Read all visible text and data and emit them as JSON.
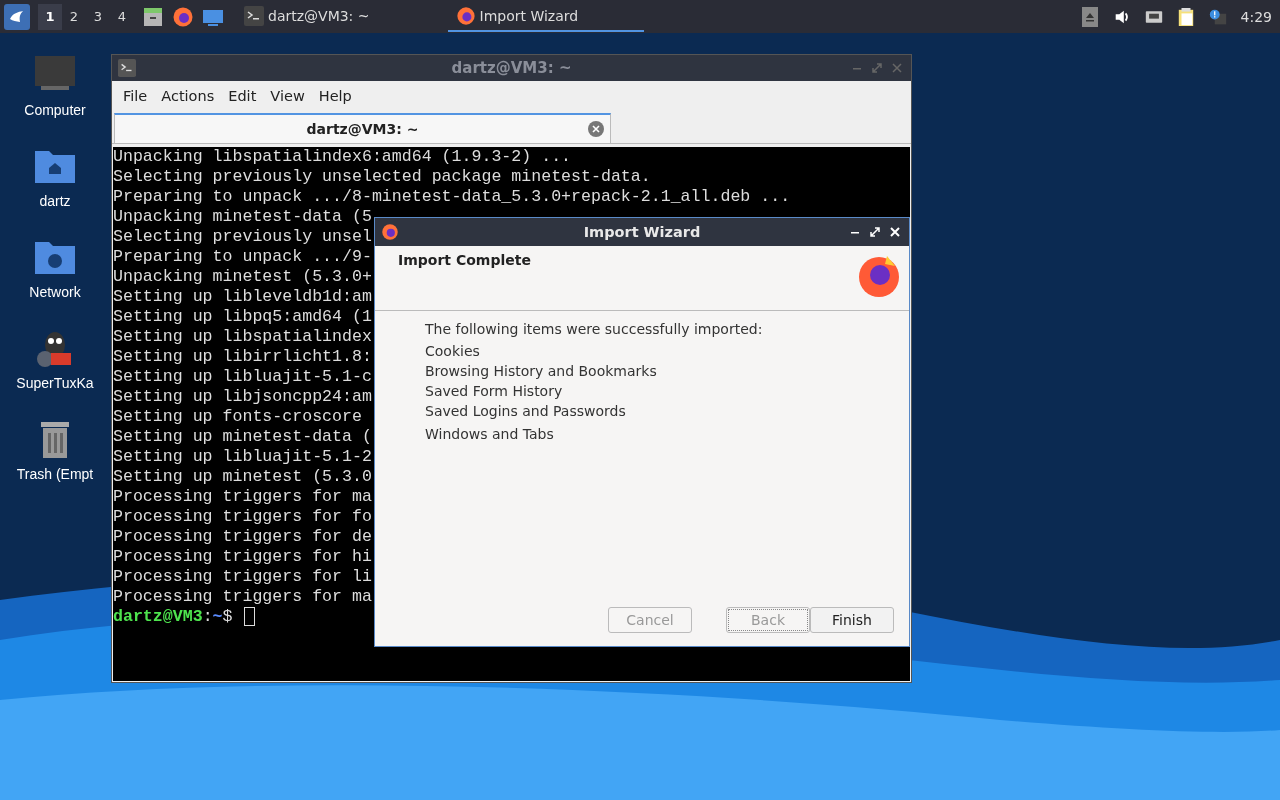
{
  "taskbar": {
    "workspaces": [
      {
        "label": "1",
        "selected": true
      },
      {
        "label": "2",
        "selected": false
      },
      {
        "label": "3",
        "selected": false
      },
      {
        "label": "4",
        "selected": false
      }
    ],
    "tasks": [
      {
        "label": "dartz@VM3: ~",
        "kind": "terminal",
        "selected": false
      },
      {
        "label": "Import Wizard",
        "kind": "firefox",
        "selected": true
      }
    ],
    "clock": "4:29"
  },
  "desktop_icons": [
    {
      "label": "Computer",
      "kind": "computer"
    },
    {
      "label": "dartz",
      "kind": "home"
    },
    {
      "label": "Network",
      "kind": "network"
    },
    {
      "label": "SuperTuxKa",
      "kind": "game"
    },
    {
      "label": "Trash (Empt",
      "kind": "trash"
    }
  ],
  "terminal": {
    "title": "dartz@VM3: ~",
    "menu": [
      "File",
      "Actions",
      "Edit",
      "View",
      "Help"
    ],
    "tab": "dartz@VM3: ~",
    "lines": [
      "Unpacking libspatialindex6:amd64 (1.9.3-2) ...",
      "Selecting previously unselected package minetest-data.",
      "Preparing to unpack .../8-minetest-data_5.3.0+repack-2.1_all.deb ...",
      "Unpacking minetest-data (5",
      "Selecting previously unsel",
      "Preparing to unpack .../9-",
      "Unpacking minetest (5.3.0+",
      "Setting up libleveldb1d:am",
      "Setting up libpq5:amd64 (1",
      "Setting up libspatialindex",
      "Setting up libirrlicht1.8:",
      "Setting up libluajit-5.1-c",
      "Setting up libjsoncpp24:am",
      "Setting up fonts-croscore",
      "Setting up minetest-data (",
      "Setting up libluajit-5.1-2",
      "Setting up minetest (5.3.0",
      "Processing triggers for ma",
      "Processing triggers for fo",
      "Processing triggers for de",
      "Processing triggers for hi",
      "Processing triggers for li",
      "Processing triggers for ma"
    ],
    "prompt": {
      "user": "dartz@VM3",
      "sep": ":",
      "path": "~",
      "symbol": "$"
    }
  },
  "wizard": {
    "title": "Import Wizard",
    "heading": "Import Complete",
    "intro": "The following items were successfully imported:",
    "items": [
      "Cookies",
      "Browsing History and Bookmarks",
      "Saved Form History",
      "Saved Logins and Passwords",
      "Windows and Tabs"
    ],
    "buttons": [
      {
        "label": "Cancel",
        "disabled": true,
        "focused": false
      },
      {
        "label": "Back",
        "disabled": true,
        "focused": true
      },
      {
        "label": "Finish",
        "disabled": false,
        "focused": false
      }
    ]
  }
}
